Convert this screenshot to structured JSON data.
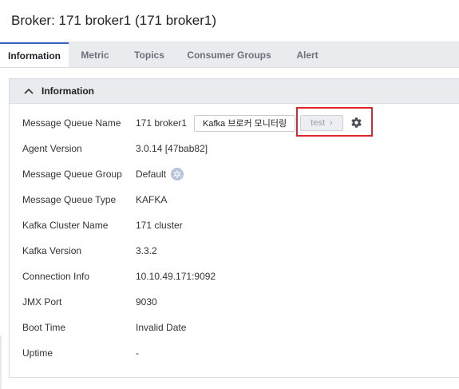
{
  "header": {
    "title": "Broker: 171 broker1 (171 broker1)"
  },
  "tabs": [
    {
      "label": "Information",
      "active": true
    },
    {
      "label": "Metric"
    },
    {
      "label": "Topics"
    },
    {
      "label": "Consumer Groups"
    },
    {
      "label": "Alert"
    }
  ],
  "panel": {
    "title": "Information",
    "icons": {
      "collapse": "chevron-up-icon",
      "settings": "gear-icon",
      "platform": "kubernetes-icon"
    },
    "rows": [
      {
        "label": "Message Queue Name",
        "value": "171 broker1"
      },
      {
        "label": "Agent Version",
        "value": "3.0.14 [47bab82]"
      },
      {
        "label": "Message Queue Group",
        "value": "Default"
      },
      {
        "label": "Message Queue Type",
        "value": "KAFKA"
      },
      {
        "label": "Kafka Cluster Name",
        "value": "171 cluster"
      },
      {
        "label": "Kafka Version",
        "value": "3.3.2"
      },
      {
        "label": "Connection Info",
        "value": "10.10.49.171:9092"
      },
      {
        "label": "JMX Port",
        "value": "9030"
      },
      {
        "label": "Boot Time",
        "value": "Invalid Date"
      },
      {
        "label": "Uptime",
        "value": "-"
      }
    ],
    "monitor_button": "Kafka 브로커 모니터링",
    "test_button": "test",
    "test_chevron": "›"
  },
  "colors": {
    "accent": "#3c63c8",
    "highlight": "#e0262a"
  }
}
